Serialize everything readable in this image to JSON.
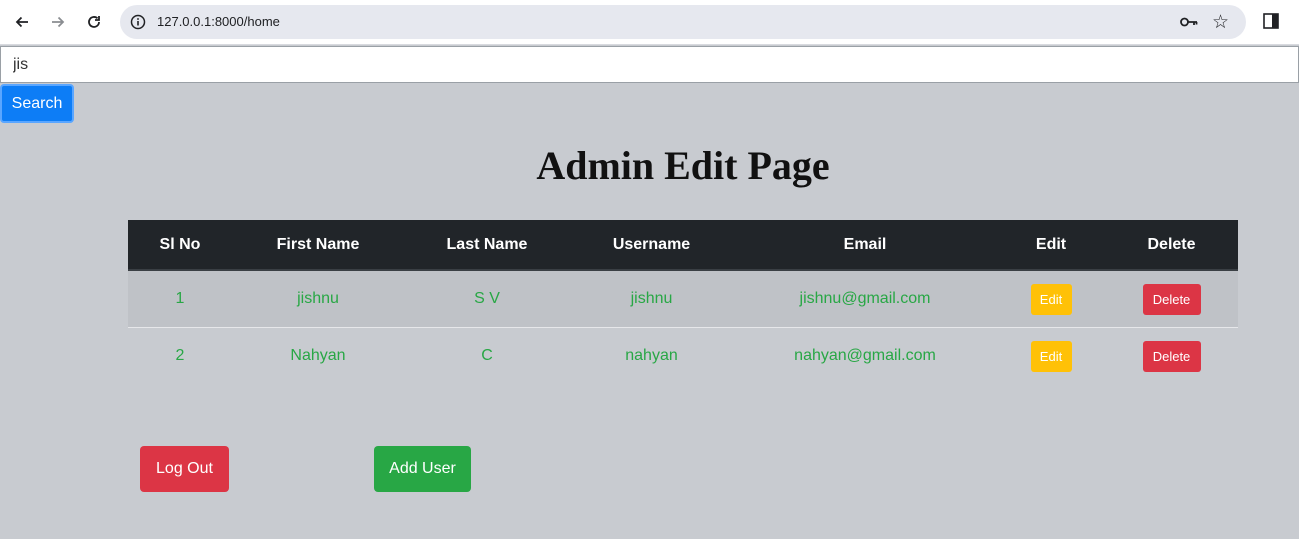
{
  "browser": {
    "url": "127.0.0.1:8000/home"
  },
  "search": {
    "value": "jis",
    "button_label": "Search"
  },
  "page_title": "Admin Edit Page",
  "table": {
    "headers": [
      "Sl No",
      "First Name",
      "Last Name",
      "Username",
      "Email",
      "Edit",
      "Delete"
    ],
    "rows": [
      {
        "sl": "1",
        "first": "jishnu",
        "last": "S V",
        "username": "jishnu",
        "email": "jishnu@gmail.com",
        "edit": "Edit",
        "delete": "Delete"
      },
      {
        "sl": "2",
        "first": "Nahyan",
        "last": "C",
        "username": "nahyan",
        "email": "nahyan@gmail.com",
        "edit": "Edit",
        "delete": "Delete"
      }
    ]
  },
  "actions": {
    "logout_label": "Log Out",
    "add_user_label": "Add User"
  },
  "colors": {
    "page_bg": "#c8cbd0",
    "header_bg": "#212529",
    "text_green": "#28a745",
    "edit_yellow": "#ffc107",
    "delete_red": "#dc3545",
    "search_blue": "#0d7df6"
  },
  "icons": [
    "back-arrow-icon",
    "forward-arrow-icon",
    "reload-icon",
    "info-icon",
    "key-icon",
    "star-icon",
    "side-panel-icon"
  ]
}
